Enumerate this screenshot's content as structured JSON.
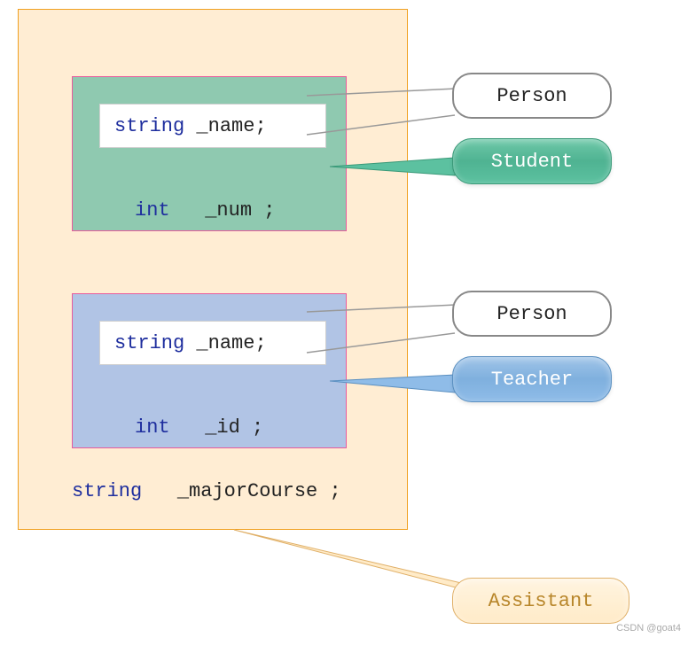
{
  "outer": {
    "student": {
      "inner_type": "string",
      "inner_name": "_name",
      "semi": ";",
      "bottom_type": "int",
      "bottom_name": "_num",
      "bottom_semi": ";"
    },
    "teacher": {
      "inner_type": "string",
      "inner_name": "_name",
      "semi": ";",
      "bottom_type": "int",
      "bottom_name": "_id",
      "bottom_semi": ";"
    },
    "major_type": "string",
    "major_name": "_majorCourse",
    "major_semi": ";"
  },
  "callouts": {
    "person1": "Person",
    "student": "Student",
    "person2": "Person",
    "teacher": "Teacher",
    "assistant": "Assistant"
  },
  "watermark": "CSDN @goat4"
}
